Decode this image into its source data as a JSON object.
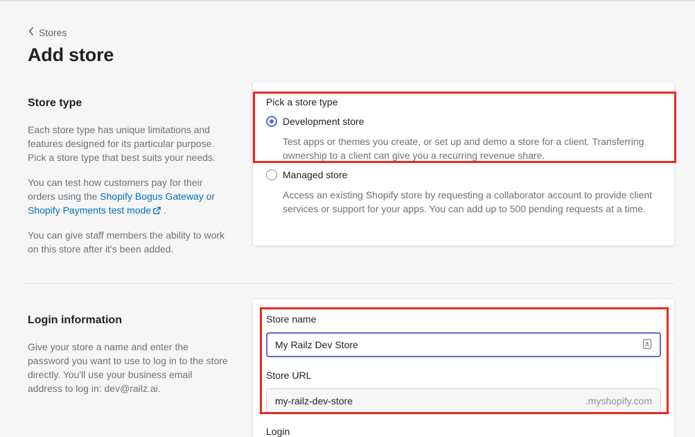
{
  "breadcrumb": {
    "label": "Stores"
  },
  "page": {
    "title": "Add store"
  },
  "store_type_section": {
    "title": "Store type",
    "desc1": "Each store type has unique limitations and features designed for its particular purpose. Pick a store type that best suits your needs.",
    "desc2_prefix": "You can test how customers pay for their orders using the ",
    "desc2_link": "Shopify Bogus Gateway or Shopify Payments test mode",
    "desc2_suffix": " .",
    "desc3": "You can give staff members the ability to work on this store after it's been added."
  },
  "store_type_card": {
    "heading": "Pick a store type",
    "options": [
      {
        "label": "Development store",
        "help": "Test apps or themes you create, or set up and demo a store for a client. Transferring ownership to a client can give you a recurring revenue share.",
        "checked": true
      },
      {
        "label": "Managed store",
        "help": "Access an existing Shopify store by requesting a collaborator account to provide client services or support for your apps. You can add up to 500 pending requests at a time.",
        "checked": false
      }
    ]
  },
  "login_section": {
    "title": "Login information",
    "desc": "Give your store a name and enter the password you want to use to log in to the store directly. You'll use your business email address to log in: dev@railz.ai."
  },
  "login_card": {
    "store_name_label": "Store name",
    "store_name_value": "My Railz Dev Store",
    "store_url_label": "Store URL",
    "store_url_value": "my-railz-dev-store",
    "store_url_suffix": ".myshopify.com",
    "login_label": "Login"
  },
  "colors": {
    "accent": "#5c6ac4",
    "link": "#006fbb",
    "highlight": "#e8281e"
  },
  "icons": [
    "chevron-left-icon",
    "external-link-icon",
    "contact-card-icon"
  ]
}
